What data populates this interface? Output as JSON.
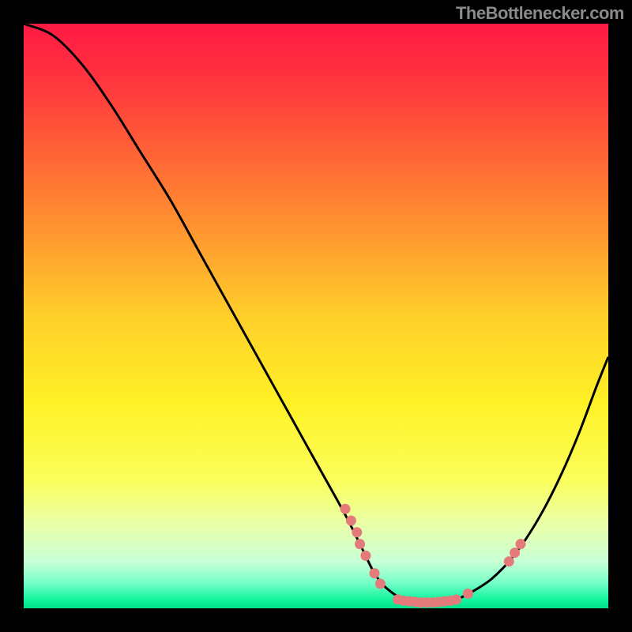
{
  "attribution": "TheBottlenecker.com",
  "chart_data": {
    "type": "line",
    "title": "",
    "xlabel": "",
    "ylabel": "",
    "xlim": [
      0,
      100
    ],
    "ylim": [
      0,
      100
    ],
    "curve": [
      {
        "x": 0,
        "y": 100
      },
      {
        "x": 5,
        "y": 98
      },
      {
        "x": 10,
        "y": 93
      },
      {
        "x": 15,
        "y": 86
      },
      {
        "x": 20,
        "y": 78
      },
      {
        "x": 25,
        "y": 70
      },
      {
        "x": 30,
        "y": 61
      },
      {
        "x": 35,
        "y": 52
      },
      {
        "x": 40,
        "y": 43
      },
      {
        "x": 45,
        "y": 34
      },
      {
        "x": 50,
        "y": 25
      },
      {
        "x": 55,
        "y": 16
      },
      {
        "x": 58,
        "y": 10
      },
      {
        "x": 60,
        "y": 6
      },
      {
        "x": 62,
        "y": 3.5
      },
      {
        "x": 65,
        "y": 1.5
      },
      {
        "x": 68,
        "y": 0.8
      },
      {
        "x": 71,
        "y": 0.8
      },
      {
        "x": 74,
        "y": 1.5
      },
      {
        "x": 77,
        "y": 3
      },
      {
        "x": 80,
        "y": 5
      },
      {
        "x": 83,
        "y": 8
      },
      {
        "x": 86,
        "y": 12
      },
      {
        "x": 89,
        "y": 17
      },
      {
        "x": 92,
        "y": 23
      },
      {
        "x": 95,
        "y": 30
      },
      {
        "x": 98,
        "y": 38
      },
      {
        "x": 100,
        "y": 43
      }
    ],
    "markers": [
      {
        "x": 55,
        "y": 17
      },
      {
        "x": 56,
        "y": 15
      },
      {
        "x": 57,
        "y": 13
      },
      {
        "x": 57.5,
        "y": 11
      },
      {
        "x": 58.5,
        "y": 9
      },
      {
        "x": 60,
        "y": 6
      },
      {
        "x": 61,
        "y": 4.2
      },
      {
        "x": 64,
        "y": 1.5
      },
      {
        "x": 65,
        "y": 1.3
      },
      {
        "x": 66,
        "y": 1.2
      },
      {
        "x": 67,
        "y": 1.1
      },
      {
        "x": 68,
        "y": 1.0
      },
      {
        "x": 69,
        "y": 1.0
      },
      {
        "x": 70,
        "y": 1.0
      },
      {
        "x": 71,
        "y": 1.1
      },
      {
        "x": 72,
        "y": 1.2
      },
      {
        "x": 73,
        "y": 1.3
      },
      {
        "x": 74,
        "y": 1.5
      },
      {
        "x": 76,
        "y": 2.5
      },
      {
        "x": 83,
        "y": 8
      },
      {
        "x": 84,
        "y": 9.5
      },
      {
        "x": 85,
        "y": 11
      }
    ],
    "gradient_stops": [
      {
        "offset": 0.0,
        "color": "#ff1a44"
      },
      {
        "offset": 0.08,
        "color": "#ff2f3f"
      },
      {
        "offset": 0.2,
        "color": "#ff5b37"
      },
      {
        "offset": 0.35,
        "color": "#ff9430"
      },
      {
        "offset": 0.5,
        "color": "#ffcf2a"
      },
      {
        "offset": 0.65,
        "color": "#fff126"
      },
      {
        "offset": 0.78,
        "color": "#fbff5c"
      },
      {
        "offset": 0.86,
        "color": "#e8ffab"
      },
      {
        "offset": 0.92,
        "color": "#c8ffd6"
      },
      {
        "offset": 0.955,
        "color": "#7affc9"
      },
      {
        "offset": 0.985,
        "color": "#14f49e"
      },
      {
        "offset": 1.0,
        "color": "#00e08b"
      }
    ],
    "marker_color": "#e47a7a",
    "curve_color": "#000000"
  }
}
